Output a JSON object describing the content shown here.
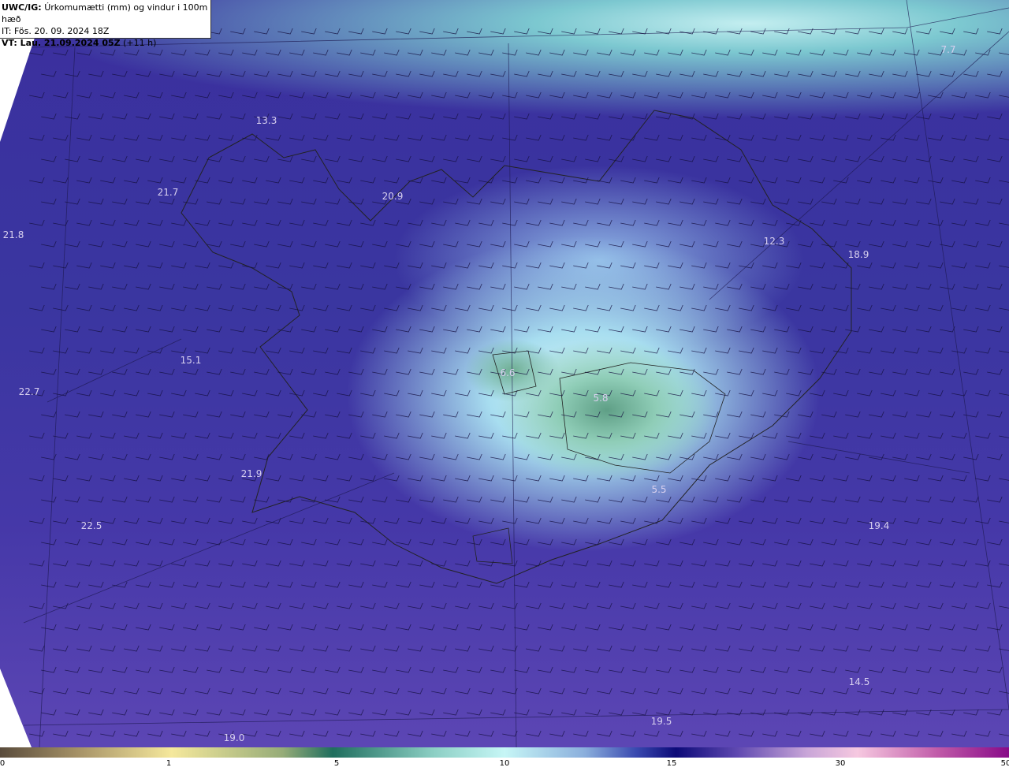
{
  "header": {
    "model": "UWC/IG:",
    "title": "Úrkomumætti (mm) og vindur i 100m hæð",
    "init_time": "IT: Fös. 20. 09. 2024 18Z",
    "valid_label": "VT: Lau. 21.09.2024 05Z",
    "lead": "(+11 h)"
  },
  "map_labels": [
    "13.3",
    "21.7",
    "20.9",
    "21.8",
    "12.3",
    "18.9",
    "15.1",
    "6.6",
    "22.7",
    "5.8",
    "21.9",
    "5.5",
    "22.5",
    "19.4",
    "14.5",
    "19.5",
    "19.0",
    "7.7"
  ],
  "colorbar": {
    "ticks": [
      "0",
      "1",
      "5",
      "10",
      "15",
      "30",
      "50"
    ],
    "colors": [
      "#5a4c3c",
      "#f5e89c",
      "#1f6e5e",
      "#c6f6f6",
      "#0c0a78",
      "#f6c8e0",
      "#880a88"
    ]
  }
}
